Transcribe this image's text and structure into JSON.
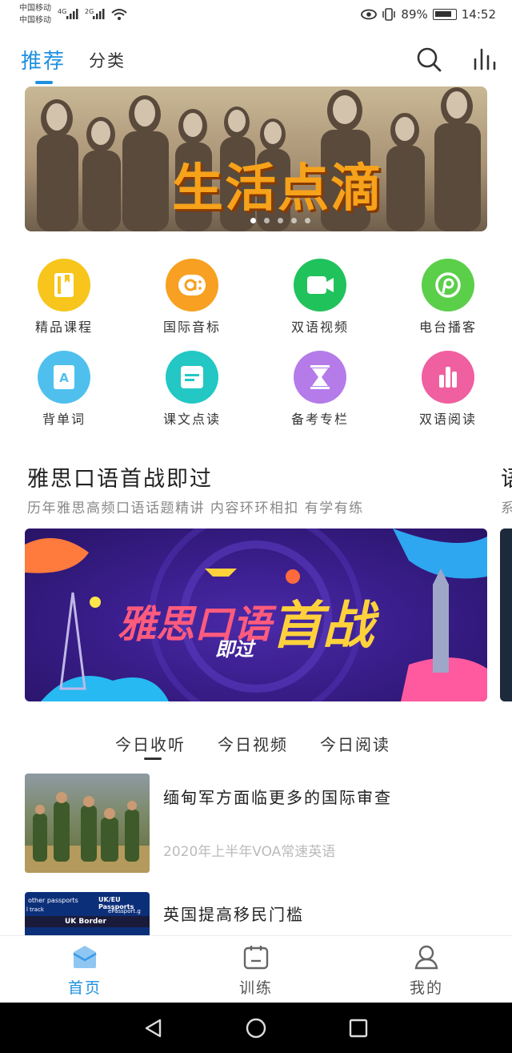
{
  "status": {
    "carrier1": "中国移动",
    "carrier2": "中国移动",
    "net1": "4G",
    "net2": "2G",
    "battery": "89%",
    "time": "14:52"
  },
  "topnav": {
    "tab_recommend": "推荐",
    "tab_category": "分类",
    "accent": "#1e90e0"
  },
  "banner": {
    "title": "生活点滴",
    "dot_count": 5,
    "active_dot": 0
  },
  "grid": [
    {
      "label": "精品课程",
      "icon": "book-icon",
      "color": "#f7c51b"
    },
    {
      "label": "国际音标",
      "icon": "phonetic-icon",
      "color": "#f7a021"
    },
    {
      "label": "双语视频",
      "icon": "video-camera-icon",
      "color": "#20c25c"
    },
    {
      "label": "电台播客",
      "icon": "radio-icon",
      "color": "#5bcf4a"
    },
    {
      "label": "背单词",
      "icon": "word-card-icon",
      "color": "#4fc0ee"
    },
    {
      "label": "课文点读",
      "icon": "text-icon",
      "color": "#23c7c4"
    },
    {
      "label": "备考专栏",
      "icon": "hourglass-icon",
      "color": "#b47be9"
    },
    {
      "label": "双语阅读",
      "icon": "bar-chart-icon",
      "color": "#f05fa0"
    }
  ],
  "course": {
    "title": "雅思口语首战即过",
    "subtitle": "历年雅思高频口语话题精讲 内容环环相扣 有学有练",
    "banner_line1": "雅思口语",
    "banner_line2": "首战",
    "banner_line3": "即过",
    "next_title": "语",
    "next_sub": "系"
  },
  "today_tabs": [
    "今日收听",
    "今日视频",
    "今日阅读"
  ],
  "list": [
    {
      "title": "缅甸军方面临更多的国际审查",
      "meta": "2020年上半年VOA常速英语"
    },
    {
      "title": "英国提高移民门槛",
      "meta": "",
      "thumb_text1": "other passports",
      "thumb_text2": "UK/EU Passports",
      "thumb_text3": "UK Border",
      "thumb_text4": "ePassport.g",
      "thumb_text5": "l track"
    }
  ],
  "bottomnav": {
    "home": "首页",
    "train": "训练",
    "mine": "我的"
  }
}
